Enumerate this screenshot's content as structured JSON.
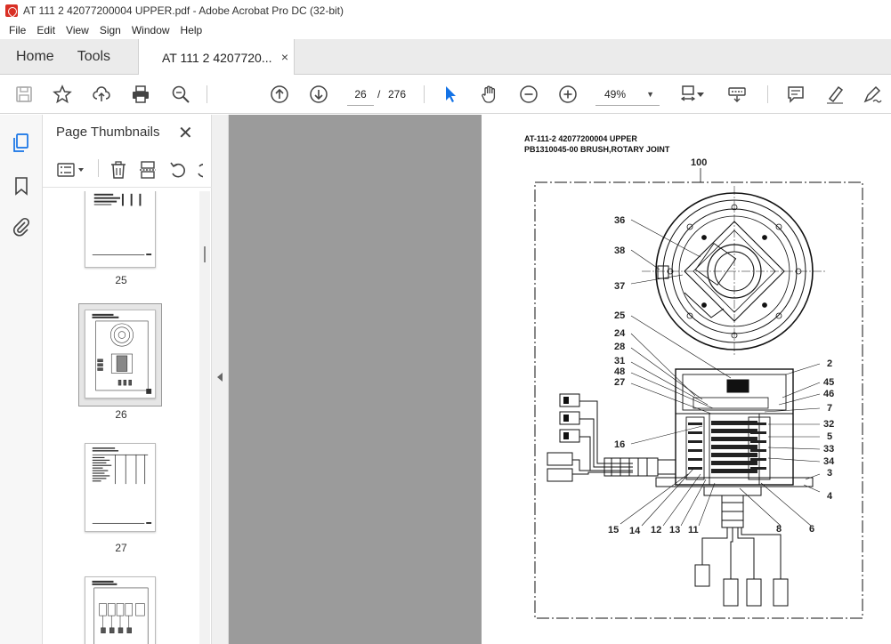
{
  "window": {
    "title": "AT 111 2 42077200004 UPPER.pdf - Adobe Acrobat Pro DC (32-bit)"
  },
  "menu": [
    "File",
    "Edit",
    "View",
    "Sign",
    "Window",
    "Help"
  ],
  "tabs": {
    "home": "Home",
    "tools": "Tools",
    "document": "AT 111 2 4207720...",
    "close_glyph": "×"
  },
  "toolbar": {
    "current_page": "26",
    "page_separator": "/",
    "total_pages": "276",
    "zoom": "49%",
    "icons": [
      "save-icon",
      "bookmark-star-icon",
      "upload-cloud-icon",
      "print-icon",
      "find-zoom-icon",
      "page-up-icon",
      "page-down-icon",
      "select-arrow-icon",
      "hand-icon",
      "zoom-out-icon",
      "zoom-in-icon",
      "fit-page-icon",
      "keyboard-icon",
      "comment-icon",
      "highlight-pen-icon",
      "sign-pen-icon"
    ]
  },
  "thumbnails_panel": {
    "title": "Page Thumbnails",
    "close_glyph": "✕",
    "pages": [
      {
        "label": "25"
      },
      {
        "label": "26",
        "selected": true
      },
      {
        "label": "27"
      },
      {
        "label": ""
      }
    ]
  },
  "document": {
    "header_line1": "AT-111-2 42077200004 UPPER",
    "header_line2": "PB1310045-00 BRUSH,ROTARY JOINT",
    "assembly_number": "100",
    "callouts": [
      "36",
      "38",
      "37",
      "25",
      "24",
      "28",
      "31",
      "48",
      "27",
      "16",
      "2",
      "45",
      "46",
      "7",
      "32",
      "5",
      "33",
      "34",
      "3",
      "4",
      "15",
      "14",
      "12",
      "13",
      "11",
      "8",
      "6"
    ]
  },
  "colors": {
    "accent_blue": "#1473e6",
    "tab_bg": "#ebebeb",
    "doc_bg": "#9b9b9b",
    "acrobat_red": "#d93025"
  }
}
